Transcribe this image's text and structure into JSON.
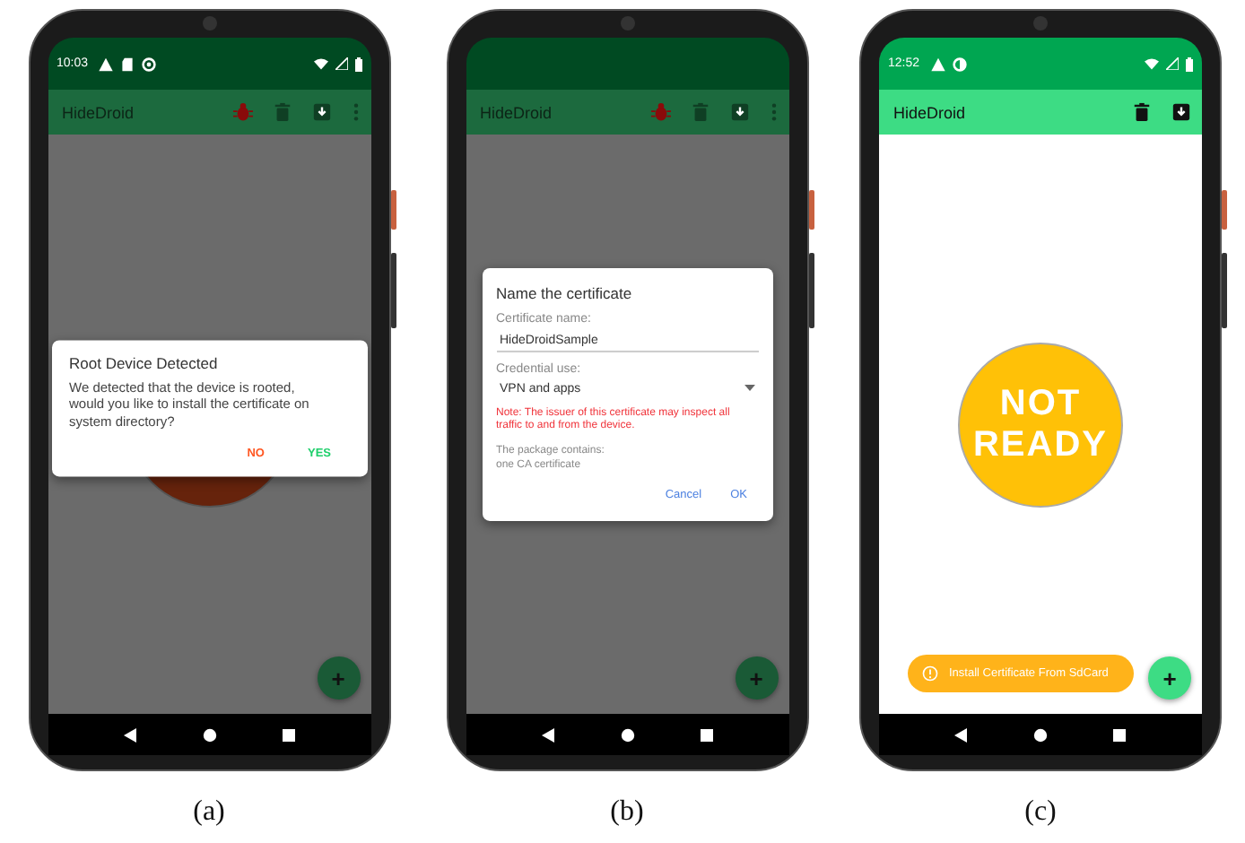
{
  "panels": [
    {
      "caption": "(a)",
      "dimmed": true,
      "status_bar": {
        "time": "10:03",
        "icons": [
          {
            "kind": "warning"
          },
          {
            "kind": "sd-card"
          },
          {
            "kind": "circle"
          }
        ]
      },
      "app_bar": {
        "title": "HideDroid",
        "actions": [
          {
            "kind": "bug"
          },
          {
            "kind": "trash"
          },
          {
            "kind": "save"
          },
          {
            "kind": "more"
          }
        ]
      },
      "status_circle": {
        "color": "#66230c"
      },
      "fab": {
        "label": "+"
      },
      "dialog": {
        "kind": "confirm",
        "title": "Root Device Detected",
        "message": "We detected that the device is rooted, would you like to install the certificate on system directory?",
        "buttons": [
          {
            "label": "NO",
            "color": "#ff5722"
          },
          {
            "label": "YES",
            "color": "#1fcf6b"
          }
        ]
      }
    },
    {
      "caption": "(b)",
      "dimmed": true,
      "app_bar": {
        "title": "HideDroid",
        "actions": [
          {
            "kind": "bug"
          },
          {
            "kind": "trash"
          },
          {
            "kind": "save"
          },
          {
            "kind": "more"
          }
        ]
      },
      "fab": {
        "label": "+"
      },
      "dialog": {
        "kind": "form",
        "title": "Name the certificate",
        "name_label": "Certificate name:",
        "name_value": "HideDroidSample",
        "use_label": "Credential use:",
        "use_value": "VPN and apps",
        "warning": "Note: The issuer of this certificate may inspect all traffic to and from the device.",
        "info": [
          "The package contains:",
          "one CA certificate"
        ],
        "buttons": [
          {
            "label": "Cancel",
            "color": "#4a7fe0"
          },
          {
            "label": "OK",
            "color": "#4a7fe0"
          }
        ]
      }
    },
    {
      "caption": "(c)",
      "dimmed": false,
      "status_bar": {
        "time": "12:52",
        "icons": [
          {
            "kind": "warning"
          },
          {
            "kind": "half-circle"
          }
        ]
      },
      "app_bar": {
        "title": "HideDroid",
        "actions": [
          {
            "kind": "trash"
          },
          {
            "kind": "save"
          }
        ]
      },
      "status_circle": {
        "label": "NOT READY",
        "color": "#ffc107"
      },
      "fab": {
        "label": "+"
      },
      "snackbar": {
        "label": "Install Certificate From SdCard"
      }
    }
  ]
}
